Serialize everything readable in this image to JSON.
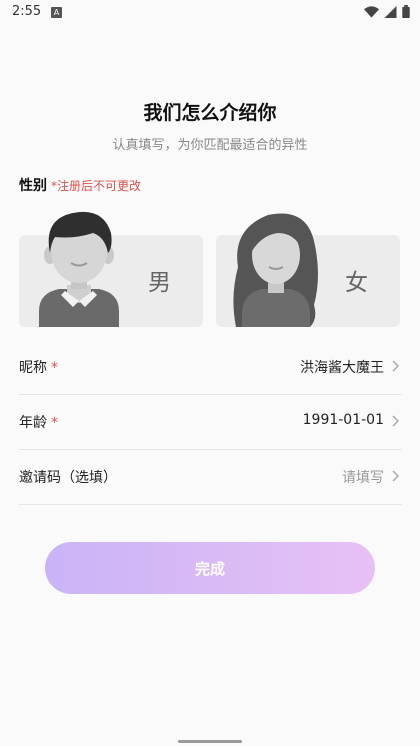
{
  "status": {
    "time": "2:55",
    "a_badge": "A"
  },
  "header": {
    "title": "我们怎么介绍你",
    "subtitle": "认真填写，为你匹配最适合的异性"
  },
  "gender": {
    "label": "性别",
    "note": "*注册后不可更改",
    "male": "男",
    "female": "女"
  },
  "fields": {
    "nickname": {
      "label": "昵称",
      "required": "*",
      "value": "洪海酱大魔王"
    },
    "age": {
      "label": "年龄",
      "required": "*",
      "value": "1991-01-01"
    },
    "invite": {
      "label": "邀请码（选填）",
      "placeholder": "请填写"
    }
  },
  "actions": {
    "done": "完成"
  }
}
